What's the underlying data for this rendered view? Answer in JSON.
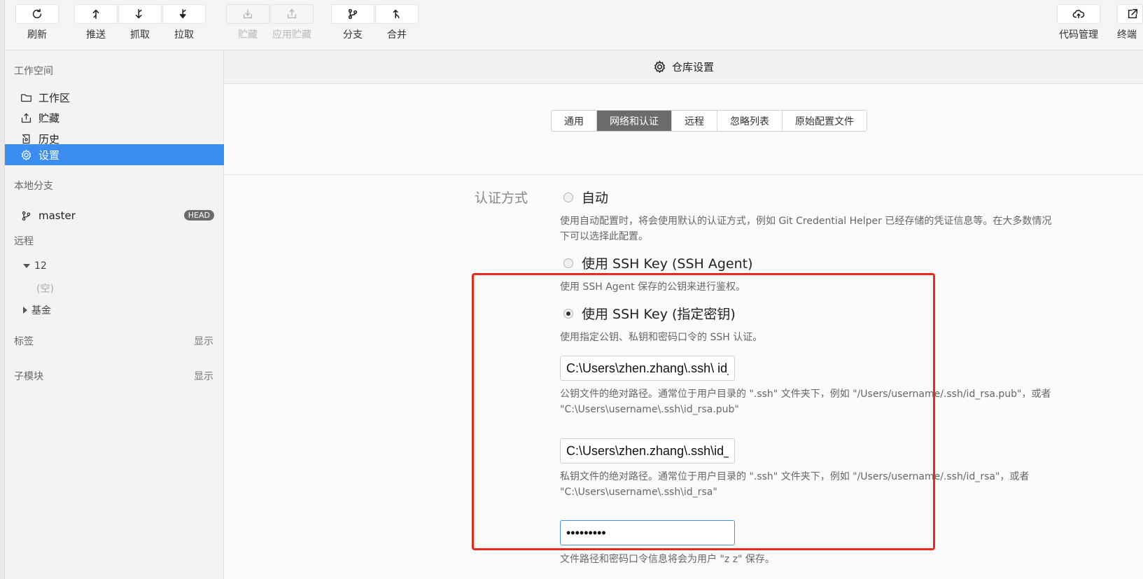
{
  "toolbar": {
    "refresh": "刷新",
    "push": "推送",
    "fetch": "抓取",
    "pull": "拉取",
    "stash": "贮藏",
    "apply_stash": "应用贮藏",
    "branch": "分支",
    "merge": "合并",
    "code_manage": "代码管理",
    "terminal": "终端"
  },
  "sidebar": {
    "workspace_title": "工作空间",
    "items": [
      {
        "label": "工作区"
      },
      {
        "label": "贮藏"
      },
      {
        "label": "历史"
      },
      {
        "label": "设置"
      }
    ],
    "local_branches_title": "本地分支",
    "branch": {
      "name": "master",
      "badge": "HEAD"
    },
    "remote_title": "远程",
    "remote": {
      "name": "12",
      "empty": "(空)",
      "other": "基金"
    },
    "tags_title": "标签",
    "tags_show": "显示",
    "submodules_title": "子模块",
    "submodules_show": "显示"
  },
  "main": {
    "header_title": "仓库设置",
    "tabs": [
      "通用",
      "网络和认证",
      "远程",
      "忽略列表",
      "原始配置文件"
    ],
    "active_tab": "网络和认证",
    "auth_label": "认证方式",
    "options": [
      {
        "label": "自动",
        "checked": false,
        "desc_line1": "使用自动配置时，将会使用默认的认证方式，例如 Git Credential Helper 已经存储的凭证信息等。在大多数情况",
        "desc_line2": "下可以选择此配置。"
      },
      {
        "label": "使用 SSH Key (SSH Agent)",
        "checked": false,
        "desc": "使用 SSH Agent 保存的公钥来进行鉴权。"
      },
      {
        "label": "使用 SSH Key (指定密钥)",
        "checked": true,
        "desc": "使用指定公钥、私钥和密码口令的 SSH 认证。"
      }
    ],
    "public_key_value": "C:\\Users\\zhen.zhang\\.ssh\\ id_rsa.pub",
    "public_key_desc_line1": "公钥文件的绝对路径。通常位于用户目录的 \".ssh\" 文件夹下，例如 \"/Users/username/.ssh/id_rsa.pub\"，或者",
    "public_key_desc_line2": "\"C:\\Users\\username\\.ssh\\id_rsa.pub\"",
    "private_key_value": "C:\\Users\\zhen.zhang\\.ssh\\id_rsa",
    "private_key_desc_line1": "私钥文件的绝对路径。通常位于用户目录的 \".ssh\" 文件夹下，例如 \"/Users/username/.ssh/id_rsa\"，或者",
    "private_key_desc_line2": "\"C:\\Users\\username\\.ssh\\id_rsa\"",
    "passphrase_value": "zzzzzzzzz",
    "save_note": "文件路径和密码口令信息将会为用户 \"z z\" 保存。"
  },
  "colors": {
    "accent": "#3b8ef0",
    "highlight_box": "#e8291c",
    "active_tab": "#6b6b6b"
  }
}
